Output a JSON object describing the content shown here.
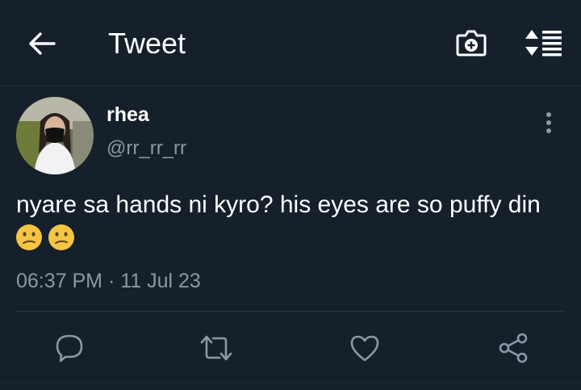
{
  "header": {
    "title": "Tweet",
    "back_icon": "arrow-left-icon",
    "camera_icon": "camera-plus-icon",
    "sort_icon": "sort-list-icon"
  },
  "tweet": {
    "author": {
      "display_name": "rhea",
      "handle": "@rr_rr_rr"
    },
    "text": "nyare sa hands ni kyro? his eyes are so puffy din",
    "emojis": [
      "confused-face",
      "confused-face"
    ],
    "timestamp": "06:37 PM · 11 Jul 23"
  },
  "actions": [
    {
      "name": "reply",
      "icon": "reply-bubble-icon"
    },
    {
      "name": "retweet",
      "icon": "retweet-icon"
    },
    {
      "name": "like",
      "icon": "heart-icon"
    },
    {
      "name": "share",
      "icon": "share-icon"
    }
  ],
  "colors": {
    "background": "#15202b",
    "text": "#ffffff",
    "secondary": "#8b98a5",
    "icon": "#8b98a5",
    "emoji": "#f4c542"
  }
}
